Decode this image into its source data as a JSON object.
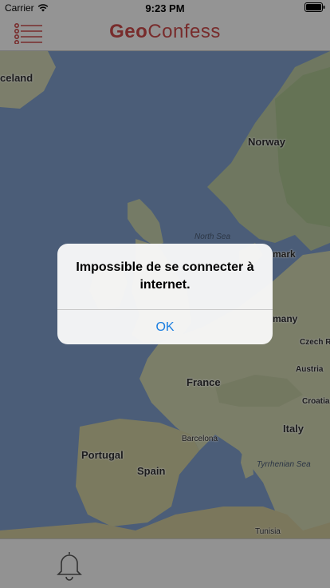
{
  "status_bar": {
    "carrier": "Carrier",
    "time": "9:23 PM"
  },
  "nav": {
    "title_part1": "Geo",
    "title_part2": "Confess",
    "menu_icon": "list-menu-icon"
  },
  "map": {
    "labels": {
      "iceland": "celand",
      "norway": "Norway",
      "north_sea": "North Sea",
      "denmark": "mark",
      "germany": "many",
      "czech": "Czech R",
      "austria": "Austria",
      "croatia": "Croatia",
      "france": "France",
      "italy": "Italy",
      "barcelona": "Barcelona",
      "portugal": "Portugal",
      "spain": "Spain",
      "tyrrhenian": "Tyrrhenian Sea",
      "tunisia": "Tunisia"
    }
  },
  "alert": {
    "message": "Impossible de se connecter à internet.",
    "ok": "OK"
  },
  "tab_bar": {
    "icon": "bell-icon"
  },
  "colors": {
    "brand": "#c84a4a",
    "link": "#1a7ee0",
    "sea": "#7d9cc9",
    "land": "#cdd2ae"
  }
}
